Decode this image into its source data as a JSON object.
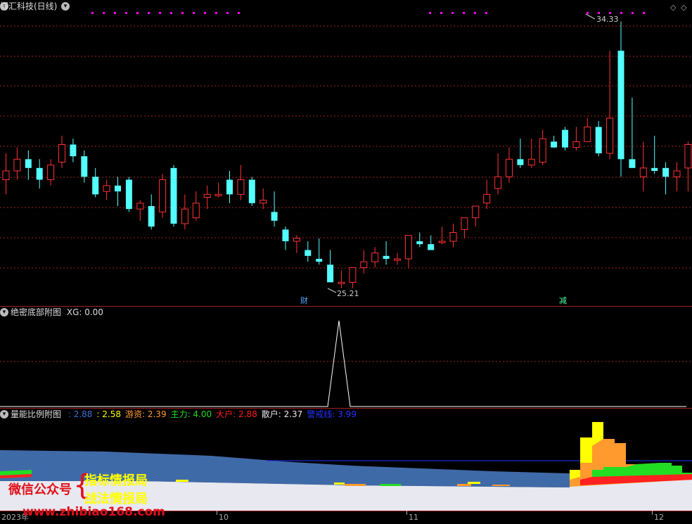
{
  "main_panel": {
    "title": "博汇科技(日线)",
    "high_label": "34.33",
    "low_label": "25.21",
    "marker_cai": "财",
    "marker_jian": "减"
  },
  "xg_panel": {
    "title": "绝密底部附图",
    "xg_text": "XG: 0.00"
  },
  "volume_panel": {
    "title": "量能比例附图",
    "legend": [
      {
        "label": ": 2.88",
        "color": "#3a6fd8"
      },
      {
        "label": ": 2.58",
        "color": "#ffff00"
      },
      {
        "label": "游资: 2.39",
        "color": "#ff9a2e"
      },
      {
        "label": "主力: 4.00",
        "color": "#22dd22"
      },
      {
        "label": "大户: 2.88",
        "color": "#ff2020"
      },
      {
        "label": "散户: 2.37",
        "color": "#e8e8e8"
      },
      {
        "label": "警戒线: 3.99",
        "color": "#2233ff"
      }
    ]
  },
  "x_axis": {
    "year_label": "2023年",
    "month_labels": [
      "10",
      "11",
      "12"
    ]
  },
  "watermark": {
    "wechat": "微信公众号",
    "line1": "指标情报局",
    "line2": "战法情报局",
    "site": "www.zhibiao168.com"
  },
  "colors": {
    "up": "#ff3333",
    "down": "#54ffff",
    "grid": "#a52020",
    "magenta_dots": "#ff00ff"
  },
  "chart_data": {
    "type": "candlestick",
    "title": "博汇科技(日线)",
    "annotations": [
      {
        "text": "34.33",
        "type": "high"
      },
      {
        "text": "25.21",
        "type": "low"
      }
    ],
    "candles": [
      [
        28.9,
        29.8,
        28.4,
        29.2
      ],
      [
        29.2,
        30.0,
        28.9,
        29.6
      ],
      [
        29.6,
        29.9,
        28.9,
        29.3
      ],
      [
        29.3,
        29.6,
        28.6,
        28.9
      ],
      [
        28.9,
        29.6,
        28.7,
        29.4
      ],
      [
        29.5,
        30.4,
        29.3,
        30.1
      ],
      [
        30.1,
        30.3,
        29.5,
        29.7
      ],
      [
        29.7,
        29.9,
        28.8,
        29.0
      ],
      [
        29.0,
        29.3,
        28.3,
        28.4
      ],
      [
        28.5,
        28.9,
        28.2,
        28.7
      ],
      [
        28.7,
        29.0,
        28.0,
        28.5
      ],
      [
        28.9,
        29.0,
        27.8,
        27.9
      ],
      [
        27.9,
        28.2,
        27.5,
        28.1
      ],
      [
        28.0,
        28.4,
        27.2,
        27.3
      ],
      [
        27.8,
        29.1,
        27.6,
        28.9
      ],
      [
        29.3,
        29.4,
        27.3,
        27.4
      ],
      [
        27.4,
        28.4,
        27.2,
        27.9
      ],
      [
        27.6,
        28.5,
        27.5,
        28.1
      ],
      [
        28.3,
        28.7,
        27.9,
        28.4
      ],
      [
        28.4,
        28.8,
        28.3,
        28.4
      ],
      [
        28.9,
        29.2,
        28.1,
        28.4
      ],
      [
        28.4,
        29.4,
        28.2,
        28.9
      ],
      [
        28.9,
        29.0,
        28.0,
        28.1
      ],
      [
        28.1,
        28.6,
        27.9,
        28.2
      ],
      [
        27.8,
        28.5,
        27.3,
        27.5
      ],
      [
        27.2,
        27.3,
        26.5,
        26.8
      ],
      [
        26.8,
        27.0,
        26.4,
        26.9
      ],
      [
        26.5,
        26.8,
        26.1,
        26.3
      ],
      [
        26.2,
        26.9,
        26.0,
        26.1
      ],
      [
        26.0,
        26.5,
        25.4,
        25.4
      ],
      [
        25.4,
        25.8,
        25.2,
        25.4
      ],
      [
        25.4,
        25.9,
        25.2,
        25.9
      ],
      [
        25.9,
        26.5,
        25.7,
        26.1
      ],
      [
        26.1,
        26.6,
        25.9,
        26.4
      ],
      [
        26.3,
        26.8,
        26.0,
        26.2
      ],
      [
        26.2,
        26.4,
        26.0,
        26.2
      ],
      [
        26.2,
        27.0,
        25.9,
        27.0
      ],
      [
        26.8,
        27.1,
        26.6,
        26.7
      ],
      [
        26.7,
        27.0,
        26.5,
        26.5
      ],
      [
        26.8,
        27.3,
        26.7,
        26.8
      ],
      [
        26.8,
        27.4,
        26.6,
        27.1
      ],
      [
        27.2,
        27.6,
        26.9,
        27.6
      ],
      [
        27.6,
        28.0,
        27.3,
        28.0
      ],
      [
        28.1,
        28.9,
        27.9,
        28.4
      ],
      [
        28.6,
        29.8,
        28.4,
        29.0
      ],
      [
        29.0,
        30.0,
        28.8,
        29.6
      ],
      [
        29.6,
        30.3,
        29.3,
        29.4
      ],
      [
        29.4,
        30.3,
        29.3,
        29.6
      ],
      [
        29.5,
        30.6,
        29.4,
        30.3
      ],
      [
        30.2,
        30.4,
        30.0,
        30.0
      ],
      [
        30.6,
        30.7,
        29.9,
        30.0
      ],
      [
        30.0,
        30.7,
        29.9,
        30.2
      ],
      [
        30.2,
        31.0,
        30.2,
        30.7
      ],
      [
        30.7,
        30.9,
        29.7,
        29.8
      ],
      [
        29.8,
        33.3,
        29.6,
        31.0
      ],
      [
        33.3,
        34.3,
        29.0,
        29.6
      ],
      [
        29.6,
        31.7,
        29.5,
        29.3
      ],
      [
        29.0,
        30.2,
        28.5,
        29.3
      ],
      [
        29.3,
        30.4,
        29.1,
        29.2
      ],
      [
        29.3,
        29.5,
        28.4,
        29.0
      ],
      [
        29.0,
        29.5,
        28.5,
        29.2
      ],
      [
        29.3,
        30.2,
        28.5,
        30.1
      ],
      [
        30.1,
        31.4,
        29.0,
        30.2
      ],
      [
        30.2,
        30.4,
        28.5,
        28.7
      ],
      [
        28.7,
        30.8,
        28.1,
        29.2
      ]
    ],
    "xg_indicator": {
      "name": "XG",
      "value": 0.0,
      "spike_count": 1
    },
    "volume_ratio": {
      "series": [
        {
          "name": "",
          "value": 2.88
        },
        {
          "name": "",
          "value": 2.58
        },
        {
          "name": "游资",
          "value": 2.39
        },
        {
          "name": "主力",
          "value": 4.0
        },
        {
          "name": "大户",
          "value": 2.88
        },
        {
          "name": "散户",
          "value": 2.37
        },
        {
          "name": "警戒线",
          "value": 3.99
        }
      ]
    }
  }
}
